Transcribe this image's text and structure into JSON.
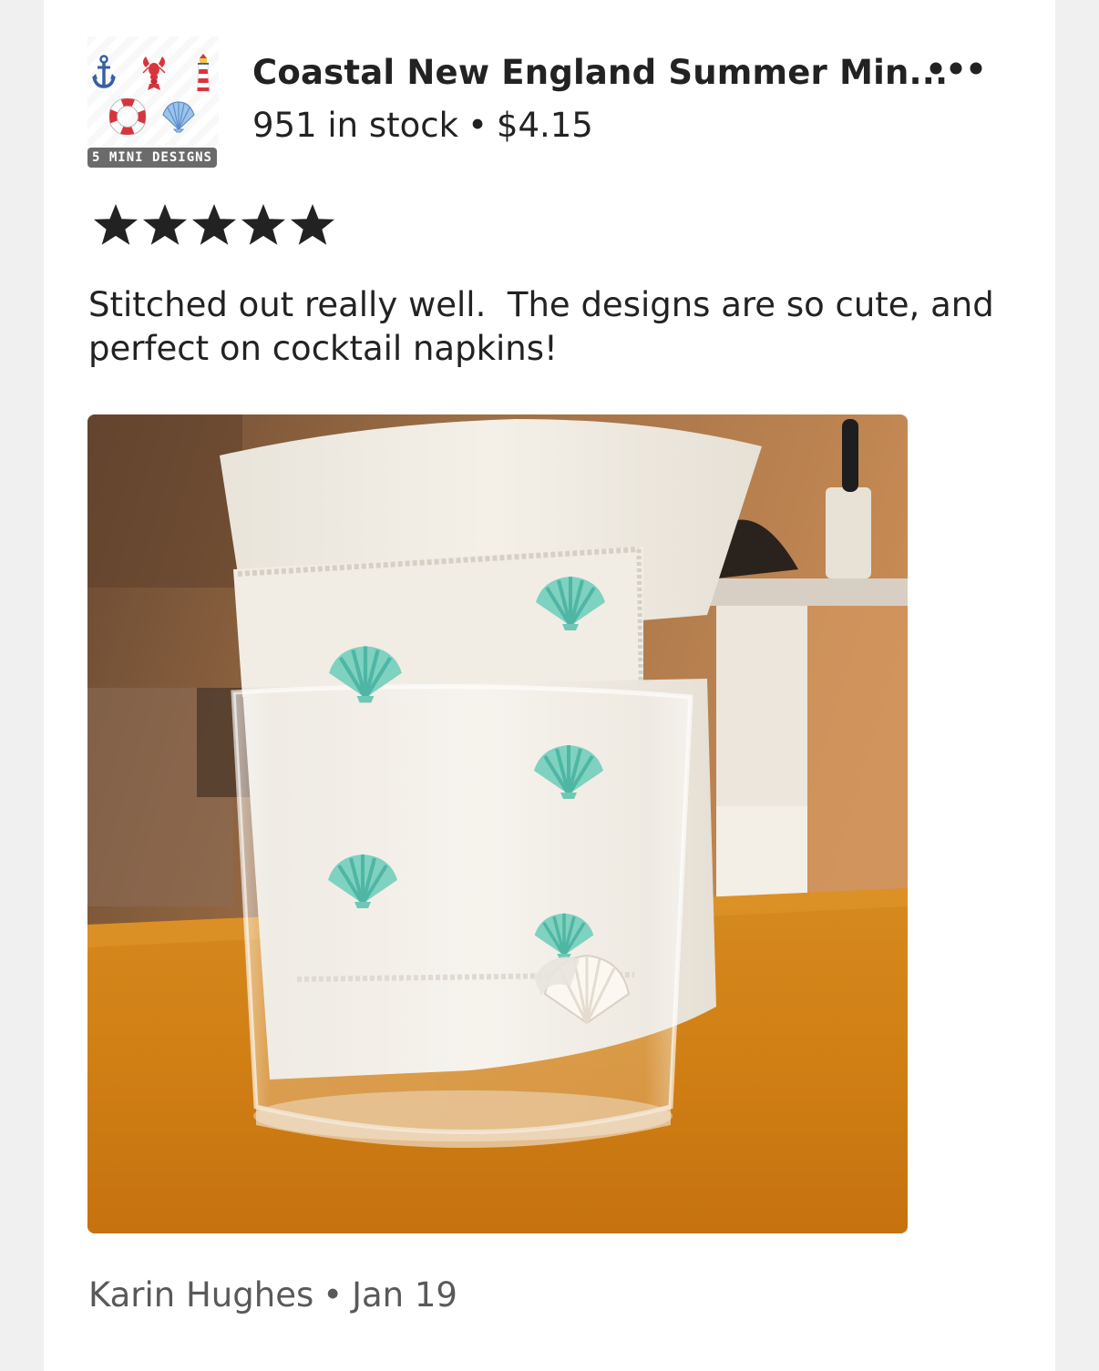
{
  "listing": {
    "title": "Coastal New England Summer Min...",
    "stock": "951 in stock",
    "separator": "•",
    "price": "$4.15",
    "thumbnail_badge": "5 MINI DESIGNS",
    "thumbnail_icons": [
      "anchor-icon",
      "lobster-icon",
      "lighthouse-icon",
      "life-ring-icon",
      "seashell-icon"
    ]
  },
  "menu": {
    "icon": "more-options-icon"
  },
  "review": {
    "rating": 5,
    "rating_max": 5,
    "text": "Stitched out really well.  The designs are so cute, and perfect on cocktail napkins!",
    "photo_alt": "Embroidered seashell cocktail napkin in a glass holder"
  },
  "reviewer": {
    "name": "Karin Hughes",
    "separator": "•",
    "date": "Jan 19"
  },
  "colors": {
    "page_background": "#f0f0f0",
    "card_background": "#ffffff",
    "text_primary": "#222222",
    "text_secondary": "#595959",
    "star": "#222222"
  }
}
